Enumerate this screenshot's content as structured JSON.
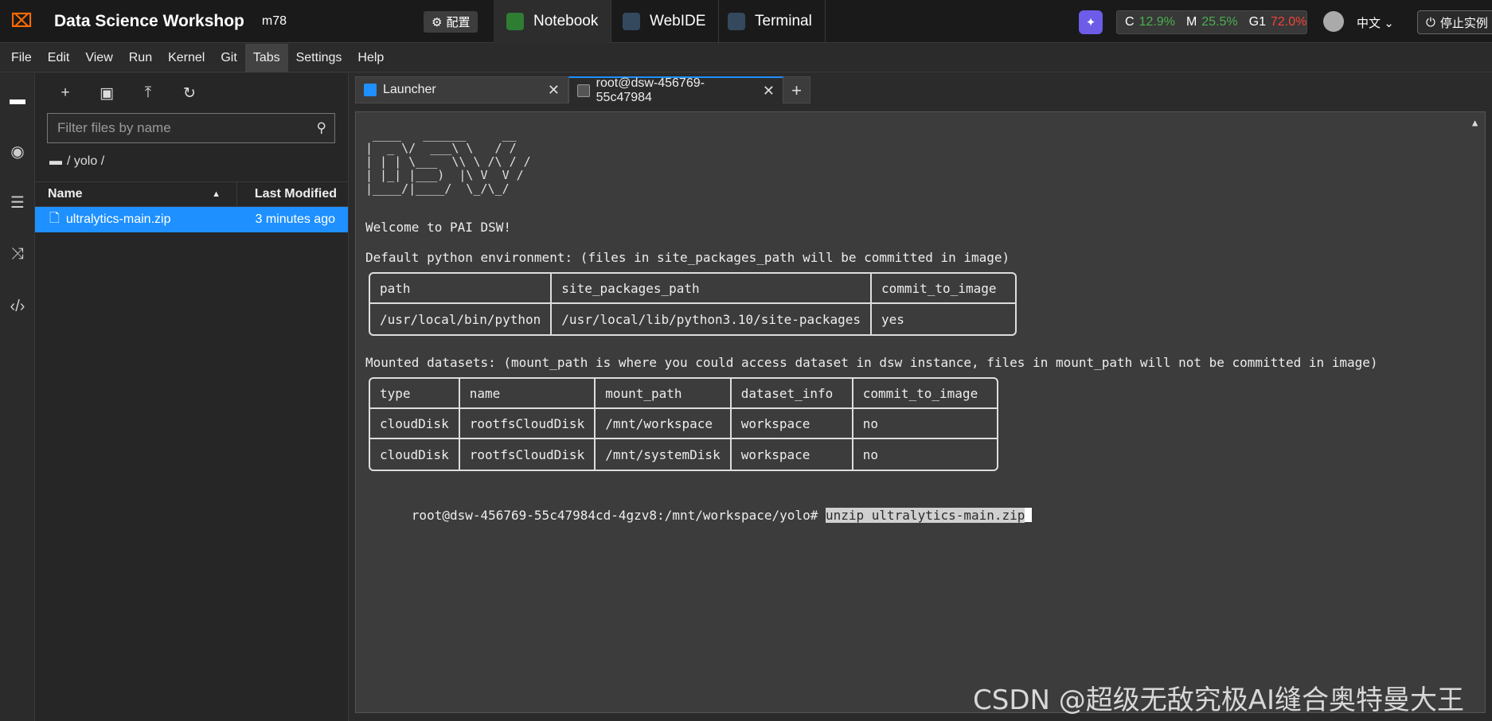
{
  "topbar": {
    "logo": "⌧",
    "app_title": "Data Science Workshop",
    "instance": "m78",
    "config_label": "配置",
    "tabs": [
      {
        "label": "Notebook"
      },
      {
        "label": "WebIDE"
      },
      {
        "label": "Terminal"
      }
    ],
    "resources": {
      "c_label": "C",
      "c_value": "12.9%",
      "m_label": "M",
      "m_value": "25.5%",
      "g_label": "G1",
      "g_value": "72.0%"
    },
    "language": "中文",
    "stop_label": "停止实例"
  },
  "menu": [
    "File",
    "Edit",
    "View",
    "Run",
    "Kernel",
    "Git",
    "Tabs",
    "Settings",
    "Help"
  ],
  "file_browser": {
    "filter_placeholder": "Filter files by name",
    "path": "/ yolo /",
    "col_name": "Name",
    "col_modified": "Last Modified",
    "files": [
      {
        "name": "ultralytics-main.zip",
        "modified": "3 minutes ago"
      }
    ]
  },
  "doc_tabs": [
    {
      "label": "Launcher"
    },
    {
      "label": "root@dsw-456769-55c47984"
    }
  ],
  "terminal": {
    "ascii_art": " ____   ______     __\n|  _ \\/  ___\\ \\   / /\n| | | \\___  \\\\ \\ /\\ / /\n| |_| |___)  |\\ V  V /\n|____/|____/  \\_/\\_/",
    "welcome": "Welcome to PAI DSW!",
    "env_heading": "Default python environment: (files in site_packages_path will be committed in image)",
    "env_table": {
      "headers": [
        "path",
        "site_packages_path",
        "commit_to_image"
      ],
      "rows": [
        [
          "/usr/local/bin/python",
          "/usr/local/lib/python3.10/site-packages",
          "yes"
        ]
      ]
    },
    "mount_heading": "Mounted datasets: (mount_path is where you could access dataset in dsw instance, files in mount_path will not be committed in image)",
    "mount_table": {
      "headers": [
        "type",
        "name",
        "mount_path",
        "dataset_info",
        "commit_to_image"
      ],
      "rows": [
        [
          "cloudDisk",
          "rootfsCloudDisk",
          "/mnt/workspace",
          "workspace",
          "no"
        ],
        [
          "cloudDisk",
          "rootfsCloudDisk",
          "/mnt/systemDisk",
          "workspace",
          "no"
        ]
      ]
    },
    "prompt": "root@dsw-456769-55c47984cd-4gzv8:/mnt/workspace/yolo# ",
    "command": "unzip ultralytics-main.zip"
  },
  "watermark": "CSDN @超级无敌究极AI缝合奥特曼大王",
  "colors": {
    "accent": "#1e90ff",
    "good": "#4caf50",
    "bad": "#f44336"
  }
}
